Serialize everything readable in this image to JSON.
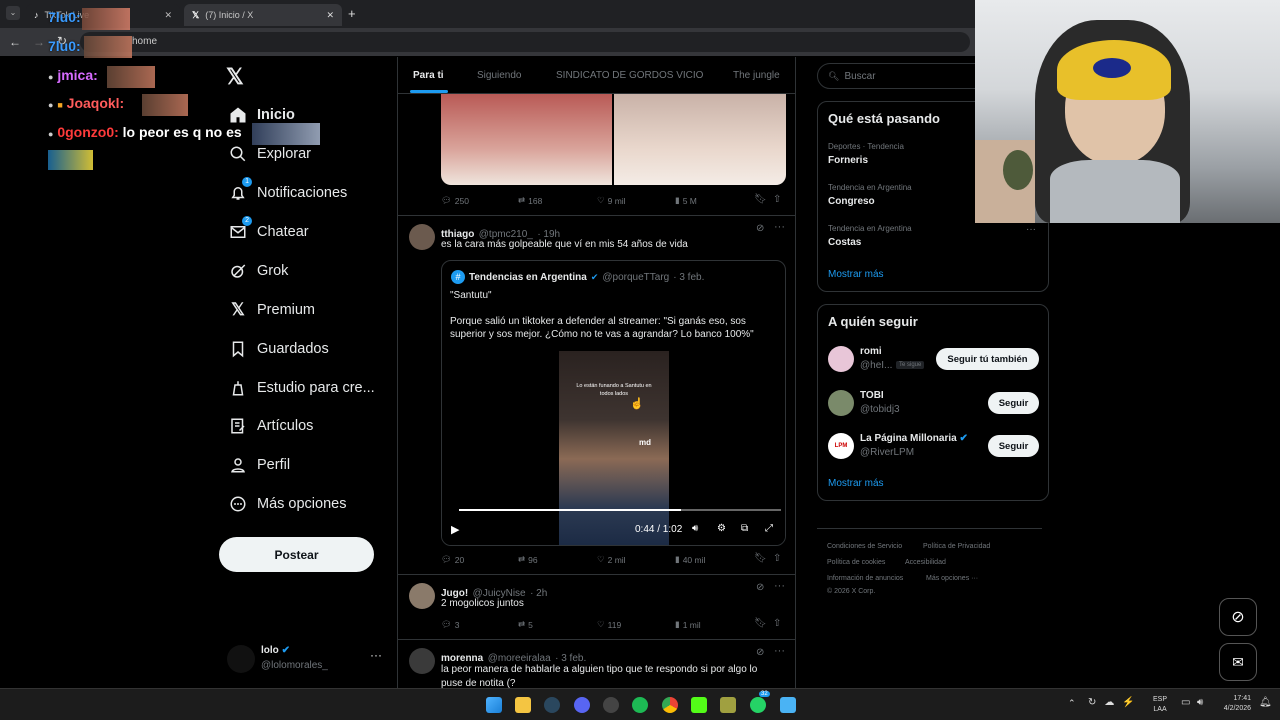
{
  "browser": {
    "tabs": [
      {
        "label": "TikTok Live"
      },
      {
        "label": "(7) Inicio / X"
      }
    ],
    "url": "home"
  },
  "chat": [
    {
      "user": "7lu0:",
      "text": "",
      "color": "#3a9bff"
    },
    {
      "user": "7lu0:",
      "text": "",
      "color": "#3a9bff"
    },
    {
      "user": "jmica:",
      "text": "",
      "color": "#d76bff"
    },
    {
      "user": "Joaqokl:",
      "text": "",
      "color": "#ff5c5c"
    },
    {
      "user": "0gonzo0:",
      "text": " lo peor es q no es",
      "color": "#ff3b3b"
    }
  ],
  "nav": {
    "items": [
      {
        "label": "Inicio",
        "icon": "home-icon"
      },
      {
        "label": "Explorar",
        "icon": "search-icon"
      },
      {
        "label": "Notificaciones",
        "icon": "bell-icon",
        "badge": "1"
      },
      {
        "label": "Chatear",
        "icon": "mail-icon",
        "badge": "2"
      },
      {
        "label": "Grok",
        "icon": "grok-icon"
      },
      {
        "label": "Premium",
        "icon": "x-logo-icon"
      },
      {
        "label": "Guardados",
        "icon": "bookmark-icon"
      },
      {
        "label": "Estudio para cre...",
        "icon": "studio-icon"
      },
      {
        "label": "Artículos",
        "icon": "article-icon"
      },
      {
        "label": "Perfil",
        "icon": "person-icon"
      },
      {
        "label": "Más opciones",
        "icon": "more-circle-icon"
      }
    ],
    "post_button": "Postear",
    "account": {
      "name": "lolo",
      "handle": "@lolomorales_"
    }
  },
  "feed": {
    "tabs": [
      "Para ti",
      "Siguiendo",
      "SINDICATO DE GORDOS VICIO",
      "The jungle"
    ],
    "tweet0_actions": {
      "replies": "250",
      "retweets": "168",
      "likes": "9 mil",
      "views": "5 M"
    },
    "tweet1": {
      "name": "tthiago",
      "handle": "@tpmc210_",
      "time": "· 19h",
      "text": "es la cara más golpeable que ví en mis 54 años de vida",
      "quote": {
        "name": "Tendencias en Argentina",
        "handle": "@porqueTTarg",
        "time": "· 3 feb.",
        "line1": "\"Santutu\"",
        "line2": "Porque salió un tiktoker a defender al streamer: \"Si ganás eso, sos superior y sos mejor. ¿Cómo no te vas a agrandar? Lo banco 100%\"",
        "video_caption": "Lo están funando a Santutu en todos lados",
        "video_tag": "md",
        "time_display": "0:44 / 1:02"
      },
      "actions": {
        "replies": "20",
        "retweets": "96",
        "likes": "2 mil",
        "views": "40 mil"
      }
    },
    "tweet2": {
      "name": "Jugo!",
      "handle": "@JuicyNise",
      "time": "· 2h",
      "text": "2 mogolicos juntos",
      "actions": {
        "replies": "3",
        "retweets": "5",
        "likes": "119",
        "views": "1 mil"
      }
    },
    "tweet3": {
      "name": "morenna",
      "handle": "@moreeiralaa",
      "time": "· 3 feb.",
      "text": "la peor manera de hablarle a alguien tipo que te respondo si por algo lo puse de notita (?"
    }
  },
  "right": {
    "search_placeholder": "Buscar",
    "trends_title": "Qué está pasando",
    "trends": [
      {
        "meta": "Deportes · Tendencia",
        "name": "Forneris"
      },
      {
        "meta": "Tendencia en Argentina",
        "name": "Congreso"
      },
      {
        "meta": "Tendencia en Argentina",
        "name": "Costas"
      }
    ],
    "show_more": "Mostrar más",
    "follow_title": "A quién seguir",
    "follow": [
      {
        "name": "romi",
        "handle": "@heI...",
        "tag": "Te sigue",
        "button": "Seguir tú también"
      },
      {
        "name": "TOBI",
        "handle": "@tobidj3",
        "tag": "",
        "button": "Seguir"
      },
      {
        "name": "La Página Millonaria",
        "handle": "@RiverLPM",
        "tag": "",
        "button": "Seguir"
      }
    ],
    "show_more2": "Mostrar más",
    "footer": [
      "Condiciones de Servicio",
      "Política de Privacidad",
      "Política de cookies",
      "Accesibilidad",
      "Información de anuncios",
      "Más opciones ···",
      "© 2026 X Corp."
    ]
  },
  "taskbar": {
    "lang1": "ESP",
    "lang2": "LAA",
    "time": "17:41",
    "date": "4/2/2026",
    "whatsapp_badge": "32"
  },
  "colors": {
    "accent": "#1d9bf0",
    "bg": "#000000",
    "border": "#2f3336"
  }
}
